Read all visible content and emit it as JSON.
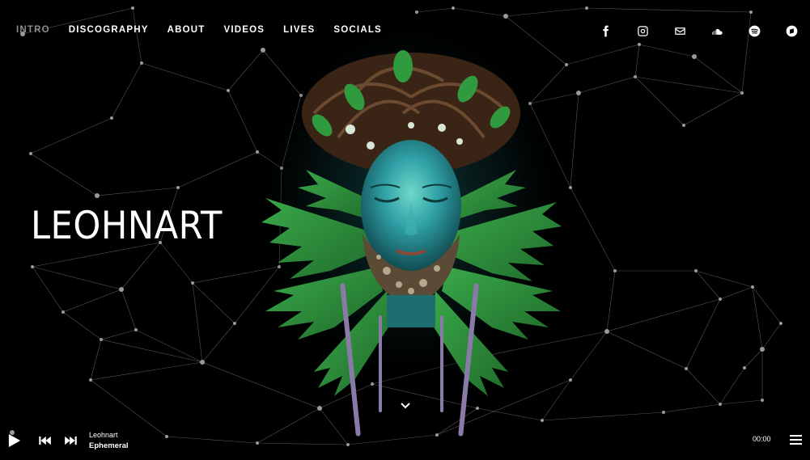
{
  "nav": {
    "items": [
      {
        "label": "INTRO",
        "active": true
      },
      {
        "label": "DISCOGRAPHY",
        "active": false
      },
      {
        "label": "ABOUT",
        "active": false
      },
      {
        "label": "VIDEOS",
        "active": false
      },
      {
        "label": "LIVES",
        "active": false
      },
      {
        "label": "SOCIALS",
        "active": false
      }
    ]
  },
  "social": [
    "facebook-icon",
    "instagram-icon",
    "email-icon",
    "soundcloud-icon",
    "spotify-icon",
    "bandcamp-icon"
  ],
  "hero": {
    "title": "LEOHNART"
  },
  "player": {
    "artist": "Leohnart",
    "track": "Ephemeral",
    "time": "00:00"
  },
  "colors": {
    "background": "#000000",
    "active_nav": "#8d8d8d",
    "text": "#ffffff"
  }
}
